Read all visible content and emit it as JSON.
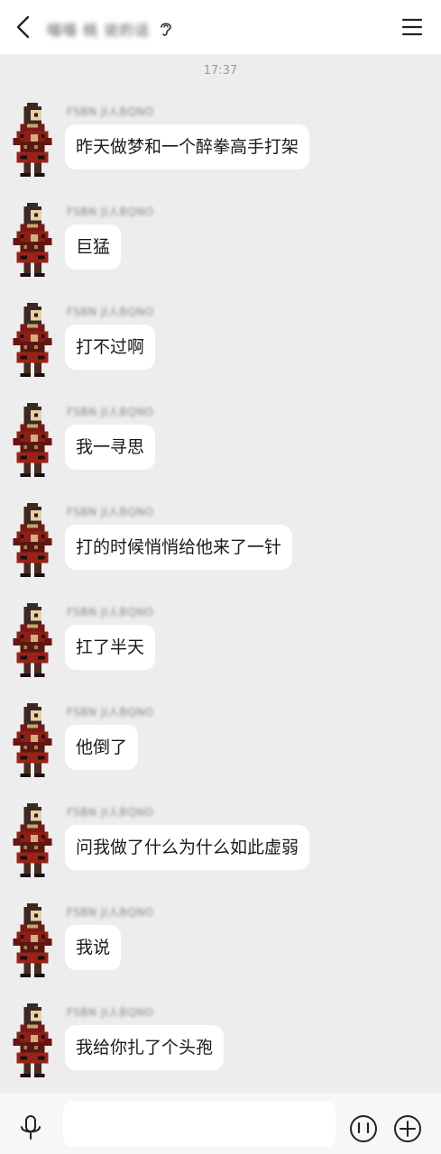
{
  "header": {
    "title": "喵喵 桃 说的话",
    "back_icon": "chevron-left-icon",
    "ear_icon": "ear-icon",
    "menu_icon": "hamburger-menu-icon"
  },
  "timestamp": "17:37",
  "messages": [
    {
      "sender": "FSBN JI人BQNO",
      "text": "昨天做梦和一个醉拳高手打架"
    },
    {
      "sender": "FSBN JI人BQNO",
      "text": "巨猛"
    },
    {
      "sender": "FSBN JI人BQNO",
      "text": "打不过啊"
    },
    {
      "sender": "FSBN JI人BQNO",
      "text": "我一寻思"
    },
    {
      "sender": "FSBN JI人BQNO",
      "text": "打的时候悄悄给他来了一针"
    },
    {
      "sender": "FSBN JI人BQNO",
      "text": "扛了半天"
    },
    {
      "sender": "FSBN JI人BQNO",
      "text": "他倒了"
    },
    {
      "sender": "FSBN JI人BQNO",
      "text": "问我做了什么为什么如此虚弱"
    },
    {
      "sender": "FSBN JI人BQNO",
      "text": "我说"
    },
    {
      "sender": "FSBN JI人BQNO",
      "text": "我给你扎了个头孢"
    }
  ],
  "input": {
    "value": "",
    "placeholder": ""
  },
  "bottom_icons": [
    "microphone-icon",
    "emoji-icon",
    "plus-icon"
  ]
}
